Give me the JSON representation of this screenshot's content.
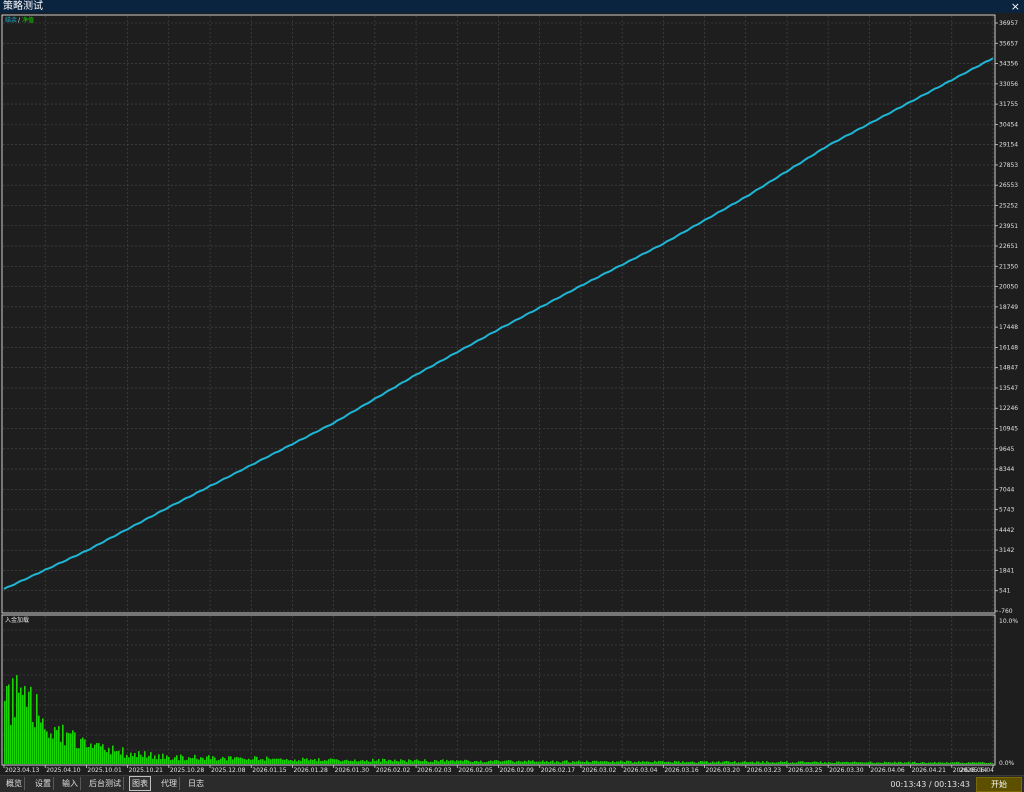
{
  "window": {
    "title": "策略测试",
    "close_label": "×"
  },
  "colors": {
    "balance": "#1fb5d4",
    "equity": "#19d400",
    "grid": "#4a4a4a",
    "panel_border": "#cfcfcf",
    "load_bar": "#19d400"
  },
  "top_chart": {
    "legend": {
      "balance": "结余",
      "separator": "/",
      "equity": "净值"
    },
    "y_ticks": [
      "-760",
      "541",
      "1841",
      "3142",
      "4442",
      "5743",
      "7044",
      "8344",
      "9645",
      "10945",
      "12246",
      "13547",
      "14847",
      "16148",
      "17448",
      "18749",
      "20050",
      "21350",
      "22651",
      "23951",
      "25252",
      "26553",
      "27853",
      "29154",
      "30454",
      "31755",
      "33056",
      "34356",
      "35657",
      "36957"
    ]
  },
  "bottom_chart": {
    "title": "入金加载",
    "y_max_label": "10.0%",
    "y_min_label": "0.0%"
  },
  "x_ticks": [
    "2023.04.13",
    "2025.04.10",
    "2025.10.01",
    "2025.10.21",
    "2025.10.28",
    "2025.12.08",
    "2026.01.15",
    "2026.01.28",
    "2026.01.30",
    "2026.02.02",
    "2026.02.03",
    "2026.02.05",
    "2026.02.09",
    "2026.02.17",
    "2026.03.02",
    "2026.03.04",
    "2026.03.16",
    "2026.03.20",
    "2026.03.23",
    "2026.03.25",
    "2026.03.30",
    "2026.04.06",
    "2026.04.21",
    "2026.05.14",
    "2026.06.04"
  ],
  "chart_data": [
    {
      "type": "line",
      "title": "",
      "x_index": [
        0,
        2,
        4,
        6,
        8,
        10,
        12,
        14,
        16,
        18,
        20,
        22,
        24
      ],
      "x_labels_at_index": [
        "2023.04.13",
        "2025.10.01",
        "2025.10.28",
        "2026.01.15",
        "2026.01.30",
        "2026.02.03",
        "2026.02.09",
        "2026.03.02",
        "2026.03.16",
        "2026.03.23",
        "2026.03.30",
        "2026.04.21",
        "2026.06.04"
      ],
      "series": [
        {
          "name": "结余",
          "values": [
            650,
            3100,
            5900,
            8600,
            11300,
            14400,
            17300,
            20100,
            22800,
            25800,
            29100,
            31900,
            34700
          ]
        }
      ],
      "ylim": [
        -760,
        37600
      ]
    },
    {
      "type": "bar",
      "title": "入金加载",
      "ylim": [
        0,
        10
      ],
      "x_index": [
        0,
        0.4,
        0.8,
        1.2,
        1.6,
        2.0,
        3.0,
        4.0,
        6.0,
        8.0,
        12.0,
        24.0
      ],
      "values": [
        5.2,
        4.5,
        3.5,
        2.5,
        2.0,
        1.2,
        0.8,
        0.5,
        0.4,
        0.3,
        0.2,
        0.1
      ]
    }
  ],
  "tabs": [
    {
      "label": "概览",
      "active": false
    },
    {
      "label": "设置",
      "active": false
    },
    {
      "label": "输入",
      "active": false
    },
    {
      "label": "后台测试",
      "active": false
    },
    {
      "label": "图表",
      "active": true
    },
    {
      "label": "代理",
      "active": false
    },
    {
      "label": "日志",
      "active": false
    }
  ],
  "status": {
    "timer": "00:13:43 / 00:13:43",
    "start_label": "开始"
  }
}
